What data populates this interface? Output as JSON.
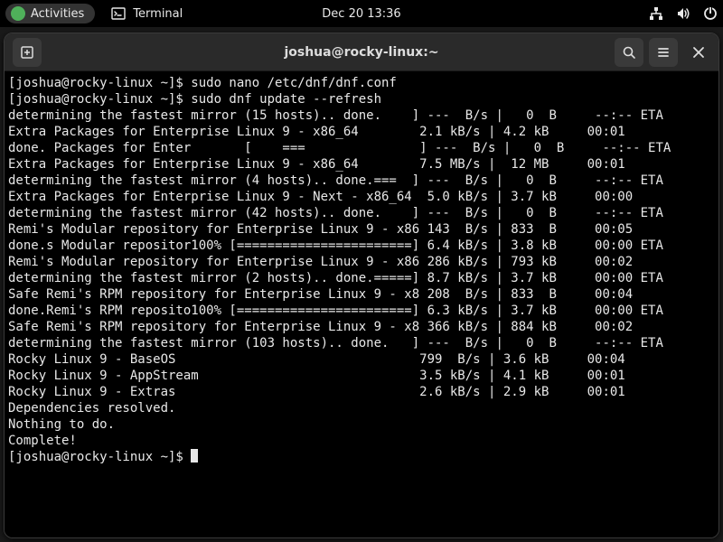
{
  "topbar": {
    "activities_label": "Activities",
    "app_label": "Terminal",
    "clock": "Dec 20  13:36"
  },
  "window": {
    "title": "joshua@rocky-linux:~"
  },
  "terminal": {
    "prompt": "[joshua@rocky-linux ~]$ ",
    "lines": [
      "[joshua@rocky-linux ~]$ sudo nano /etc/dnf/dnf.conf",
      "[joshua@rocky-linux ~]$ sudo dnf update --refresh",
      "determining the fastest mirror (15 hosts).. done.    ] ---  B/s |   0  B     --:-- ETA",
      "Extra Packages for Enterprise Linux 9 - x86_64        2.1 kB/s | 4.2 kB     00:01    ",
      "done. Packages for Enter       [    ===               ] ---  B/s |   0  B     --:-- ETA",
      "Extra Packages for Enterprise Linux 9 - x86_64        7.5 MB/s |  12 MB     00:01    ",
      "determining the fastest mirror (4 hosts).. done.===  ] ---  B/s |   0  B     --:-- ETA",
      "Extra Packages for Enterprise Linux 9 - Next - x86_64  5.0 kB/s | 3.7 kB     00:00    ",
      "determining the fastest mirror (42 hosts).. done.    ] ---  B/s |   0  B     --:-- ETA",
      "Remi's Modular repository for Enterprise Linux 9 - x86 143  B/s | 833  B     00:05    ",
      "done.s Modular repositor100% [=======================] 6.4 kB/s | 3.8 kB     00:00 ETA",
      "Remi's Modular repository for Enterprise Linux 9 - x86 286 kB/s | 793 kB     00:02    ",
      "determining the fastest mirror (2 hosts).. done.=====] 8.7 kB/s | 3.7 kB     00:00 ETA",
      "Safe Remi's RPM repository for Enterprise Linux 9 - x8 208  B/s | 833  B     00:04    ",
      "done.Remi's RPM reposito100% [=======================] 6.3 kB/s | 3.7 kB     00:00 ETA",
      "Safe Remi's RPM repository for Enterprise Linux 9 - x8 366 kB/s | 884 kB     00:02    ",
      "determining the fastest mirror (103 hosts).. done.   ] ---  B/s |   0  B     --:-- ETA",
      "Rocky Linux 9 - BaseOS                                799  B/s | 3.6 kB     00:04    ",
      "Rocky Linux 9 - AppStream                             3.5 kB/s | 4.1 kB     00:01    ",
      "Rocky Linux 9 - Extras                                2.6 kB/s | 2.9 kB     00:01    ",
      "Dependencies resolved.",
      "Nothing to do.",
      "Complete!"
    ]
  }
}
